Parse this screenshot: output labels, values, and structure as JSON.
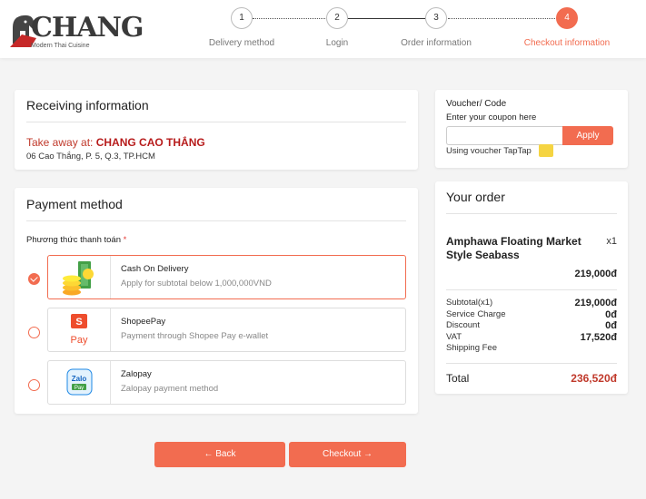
{
  "brand": {
    "name": "CHANG",
    "tagline": "Modern Thai Cuisine"
  },
  "steps": [
    {
      "number": "1",
      "label": "Delivery method",
      "active": false
    },
    {
      "number": "2",
      "label": "Login",
      "active": false
    },
    {
      "number": "3",
      "label": "Order information",
      "active": false
    },
    {
      "number": "4",
      "label": "Checkout information",
      "active": true
    }
  ],
  "receiving": {
    "title": "Receiving information",
    "take_away_label": "Take away at:",
    "store_name": "CHANG CAO THẮNG",
    "address": "06 Cao Thắng, P. 5, Q.3, TP.HCM"
  },
  "payment": {
    "title": "Payment method",
    "subtitle": "Phương thức thanh toán",
    "required_mark": "*",
    "options": [
      {
        "title": "Cash On Delivery",
        "desc": "Apply for subtotal below 1,000,000VND",
        "selected": true,
        "icon": "cash-icon"
      },
      {
        "title": "ShopeePay",
        "desc": "Payment through Shopee Pay e-wallet",
        "selected": false,
        "icon": "shopeepay-icon"
      },
      {
        "title": "Zalopay",
        "desc": "Zalopay payment method",
        "selected": false,
        "icon": "zalopay-icon"
      }
    ]
  },
  "buttons": {
    "back": "← Back",
    "checkout": "Checkout →"
  },
  "voucher": {
    "title": "Voucher/ Code",
    "subtitle": "Enter your coupon here",
    "input_value": "",
    "apply": "Apply",
    "taptap": "Using voucher TapTap"
  },
  "order": {
    "title": "Your order",
    "item": {
      "name": "Amphawa Floating Market Style Seabass",
      "qty": "x1",
      "price": "219,000đ"
    },
    "summary": [
      {
        "label": "Subtotal(x1)",
        "value": "219,000đ"
      },
      {
        "label": "Service Charge",
        "value": "0đ"
      },
      {
        "label": "Discount",
        "value": "0đ"
      },
      {
        "label": "VAT",
        "value": "17,520đ"
      },
      {
        "label": "Shipping Fee",
        "value": ""
      }
    ],
    "total_label": "Total",
    "total_value": "236,520đ"
  },
  "colors": {
    "accent": "#f26c50",
    "price_red": "#c0392b"
  }
}
